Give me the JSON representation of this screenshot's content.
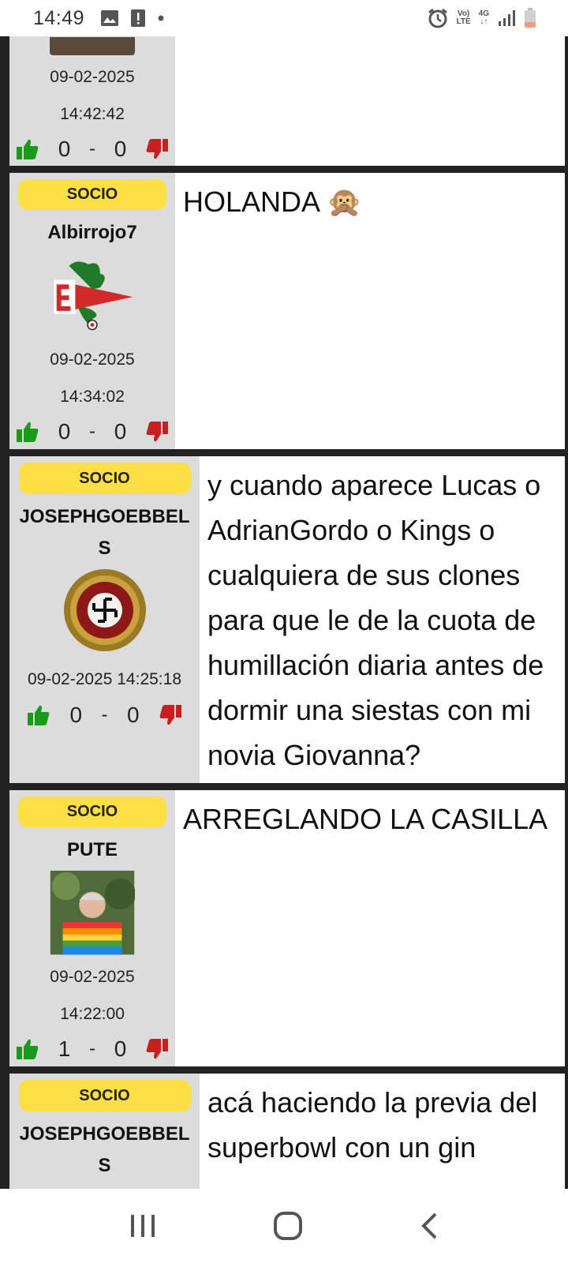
{
  "status_bar": {
    "time": "14:49",
    "net_top": "Vo)",
    "net_bottom": "LTE",
    "gen_top": "4G",
    "gen_bottom": "↓↑"
  },
  "posts": [
    {
      "date": "09-02-2025",
      "time": "14:42:42",
      "likes": "0",
      "separator": "-",
      "dislikes": "0",
      "message": ""
    },
    {
      "badge": "SOCIO",
      "username": "Albirrojo7",
      "date": "09-02-2025",
      "time": "14:34:02",
      "likes": "0",
      "separator": "-",
      "dislikes": "0",
      "message": "HOLANDA 🙊"
    },
    {
      "badge": "SOCIO",
      "username": "JOSEPHGOEBBELS",
      "datetime": "09-02-2025 14:25:18",
      "likes": "0",
      "separator": "-",
      "dislikes": "0",
      "message": "y cuando aparece Lucas o AdrianGordo o Kings o cualquiera de sus clones para que le de la cuota de humillación diaria antes de dormir una siestas con mi novia Giovanna?"
    },
    {
      "badge": "SOCIO",
      "username": "PUTE",
      "date": "09-02-2025",
      "time": "14:22:00",
      "likes": "1",
      "separator": "-",
      "dislikes": "0",
      "message": "ARREGLANDO LA CASILLA"
    },
    {
      "badge": "SOCIO",
      "username": "JOSEPHGOEBBELS",
      "message": "acá haciendo la previa del superbowl con un gin"
    }
  ],
  "colors": {
    "badge": "#ffe044",
    "meta_bg": "#dcdcdc",
    "thumb_up": "#1a9a1a",
    "thumb_down": "#c62020"
  }
}
